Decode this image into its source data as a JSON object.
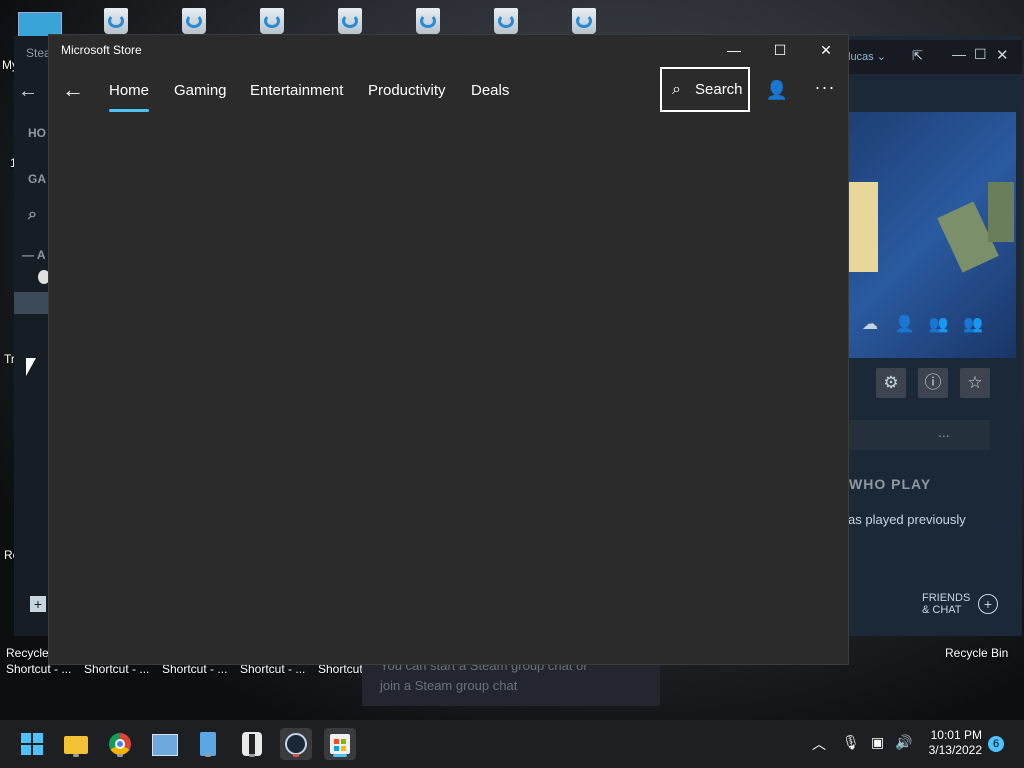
{
  "desktop": {
    "left_labels": [
      "My",
      "1",
      "Tr",
      "Re"
    ],
    "recycle_bin_left": "Recycle",
    "recycle_bin_right": "Recycle Bin",
    "shortcuts": [
      "Shortcut - ...",
      "Shortcut - ...",
      "Shortcut - ...",
      "Shortcut - ...",
      "Shortcut"
    ]
  },
  "steam": {
    "title_partial": "Stea",
    "user": "lucas",
    "left_labels": [
      "HO",
      "GA",
      "A"
    ],
    "section_heading": "WHO PLAY",
    "played_text": "as played previously",
    "friends_chat": "FRIENDS\n& CHAT",
    "chat_hint": "You can start a Steam group chat or\njoin a Steam group chat",
    "more": "..."
  },
  "store": {
    "title": "Microsoft Store",
    "nav": {
      "back": "←",
      "tabs": [
        {
          "label": "Home",
          "active": true
        },
        {
          "label": "Gaming",
          "active": false
        },
        {
          "label": "Entertainment",
          "active": false
        },
        {
          "label": "Productivity",
          "active": false
        },
        {
          "label": "Deals",
          "active": false
        }
      ],
      "search_label": "Search"
    },
    "window_buttons": {
      "minimize": "—",
      "maximize": "☐",
      "close": "✕"
    }
  },
  "taskbar": {
    "apps": [
      "start-icon",
      "file-explorer-icon",
      "chrome-icon",
      "photos-icon",
      "notepad-icon",
      "tool-icon",
      "steam-icon",
      "store-icon"
    ],
    "clock_time": "10:01 PM",
    "clock_date": "3/13/2022",
    "notification_count": "6"
  },
  "colors": {
    "accent": "#4cc2ff",
    "store_bg": "#2b2b2b",
    "steam_bg": "#1b2838",
    "taskbar_bg": "#1e1f22"
  }
}
